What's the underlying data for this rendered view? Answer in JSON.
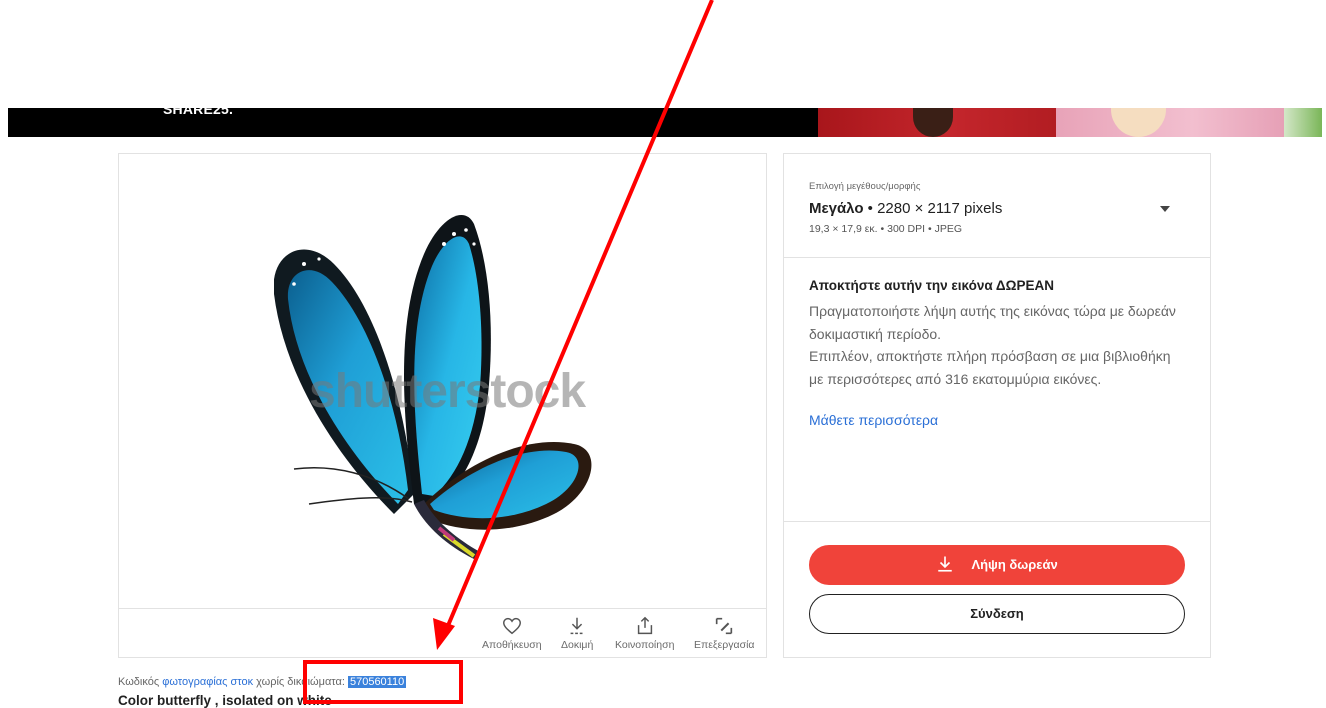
{
  "banner": {
    "text": "SHARE25."
  },
  "image": {
    "watermark": "shutterstock",
    "actions": [
      {
        "label": "Αποθήκευση",
        "icon": "heart-icon"
      },
      {
        "label": "Δοκιμή",
        "icon": "download-preview-icon"
      },
      {
        "label": "Κοινοποίηση",
        "icon": "share-icon"
      },
      {
        "label": "Επεξεργασία",
        "icon": "edit-icon"
      }
    ]
  },
  "size_select": {
    "label": "Επιλογή μεγέθους/μορφής",
    "name": "Μεγάλο",
    "dimensions": "• 2280 × 2117 pixels",
    "meta": "19,3 × 17,9 εκ. • 300 DPI • JPEG"
  },
  "free_offer": {
    "title": "Αποκτήστε αυτήν την εικόνα ΔΩΡΕΑΝ",
    "line1": "Πραγματοποιήστε λήψη αυτής της εικόνας τώρα με δωρεάν δοκιμαστική περίοδο.",
    "line2": "Επιπλέον, αποκτήστε πλήρη πρόσβαση σε μια βιβλιοθήκη με περισσότερες από 316 εκατομμύρια εικόνες.",
    "learn_more": "Μάθετε περισσότερα"
  },
  "buttons": {
    "download": "Λήψη δωρεάν",
    "login": "Σύνδεση"
  },
  "stock": {
    "prefix": "Κωδικός ",
    "link": "φωτογραφίας στοκ",
    "middle": " χωρίς δικαιώματα: ",
    "id": "570560110",
    "caption": "Color butterfly , isolated on white"
  },
  "colors": {
    "accent_red": "#f0433a",
    "link_blue": "#2a6fd6",
    "annotation_red": "#ff0000"
  }
}
